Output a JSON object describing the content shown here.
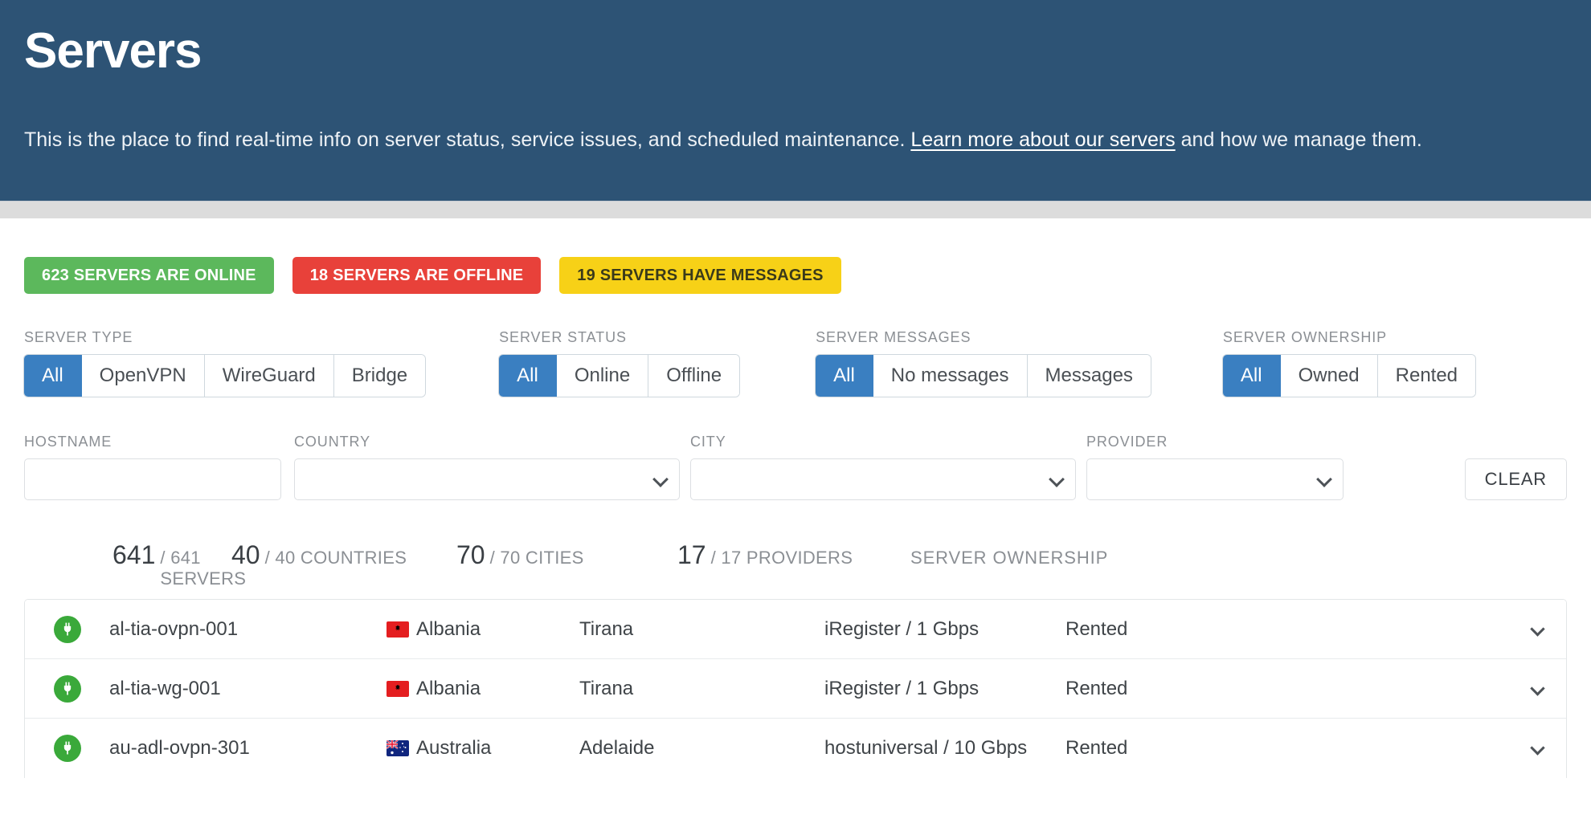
{
  "hero": {
    "title": "Servers",
    "description_before": "This is the place to find real-time info on server status, service issues, and scheduled maintenance. ",
    "link_text": "Learn more about our servers",
    "description_after": " and how we manage them."
  },
  "badges": [
    {
      "label": "623 SERVERS ARE ONLINE",
      "color": "#5cb85c"
    },
    {
      "label": "18 SERVERS ARE OFFLINE",
      "color": "#e8413a"
    },
    {
      "label": "19 SERVERS HAVE MESSAGES",
      "color": "#f7d117"
    }
  ],
  "toggle_filters": [
    {
      "label": "SERVER TYPE",
      "options": [
        "All",
        "OpenVPN",
        "WireGuard",
        "Bridge"
      ],
      "selected": "All"
    },
    {
      "label": "SERVER STATUS",
      "options": [
        "All",
        "Online",
        "Offline"
      ],
      "selected": "All"
    },
    {
      "label": "SERVER MESSAGES",
      "options": [
        "All",
        "No messages",
        "Messages"
      ],
      "selected": "All"
    },
    {
      "label": "SERVER OWNERSHIP",
      "options": [
        "All",
        "Owned",
        "Rented"
      ],
      "selected": "All"
    }
  ],
  "field_filters": {
    "hostname": {
      "label": "HOSTNAME",
      "value": "",
      "placeholder": ""
    },
    "country": {
      "label": "COUNTRY",
      "value": "",
      "icon": "chevron-down-icon"
    },
    "city": {
      "label": "CITY",
      "value": "",
      "icon": "chevron-down-icon"
    },
    "provider": {
      "label": "PROVIDER",
      "value": "",
      "icon": "chevron-down-icon"
    },
    "clear_label": "CLEAR"
  },
  "summary": {
    "servers": {
      "current": "641",
      "total": "/ 641 SERVERS"
    },
    "countries": {
      "current": "40",
      "total": "/ 40 COUNTRIES"
    },
    "cities": {
      "current": "70",
      "total": "/ 70 CITIES"
    },
    "providers": {
      "current": "17",
      "total": "/ 17 PROVIDERS"
    },
    "ownership_header": "SERVER OWNERSHIP"
  },
  "rows": [
    {
      "status": "online",
      "status_icon": "power-plug-icon",
      "hostname": "al-tia-ovpn-001",
      "country": "Albania",
      "country_flag": "al",
      "city": "Tirana",
      "provider": "iRegister / 1 Gbps",
      "ownership": "Rented",
      "expand_icon": "chevron-down-icon"
    },
    {
      "status": "online",
      "status_icon": "power-plug-icon",
      "hostname": "al-tia-wg-001",
      "country": "Albania",
      "country_flag": "al",
      "city": "Tirana",
      "provider": "iRegister / 1 Gbps",
      "ownership": "Rented",
      "expand_icon": "chevron-down-icon"
    },
    {
      "status": "online",
      "status_icon": "power-plug-icon",
      "hostname": "au-adl-ovpn-301",
      "country": "Australia",
      "country_flag": "au",
      "city": "Adelaide",
      "provider": "hostuniversal / 10 Gbps",
      "ownership": "Rented",
      "expand_icon": "chevron-down-icon"
    }
  ],
  "colors": {
    "header_bg": "#2d5375",
    "accent_blue": "#3a7fc1",
    "online_green": "#3aa93a",
    "offline_red": "#d9534f",
    "badge_yellow": "#f7d117"
  }
}
